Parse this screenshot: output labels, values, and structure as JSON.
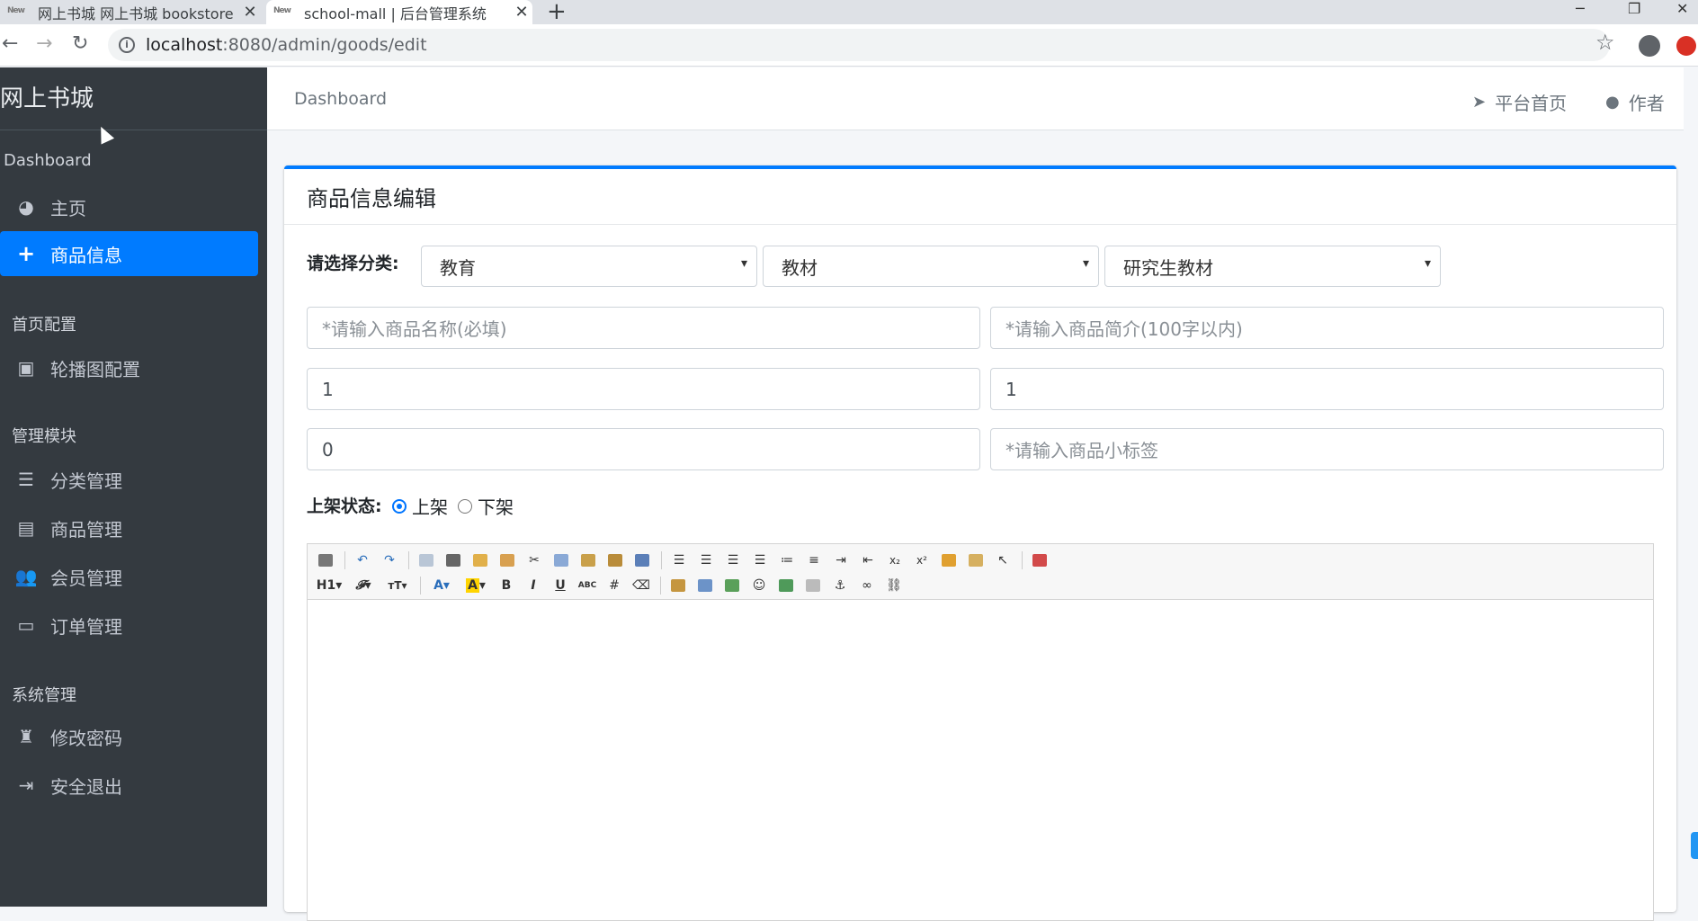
{
  "browser": {
    "tabs": [
      {
        "favicon": "New",
        "title": "网上书城 网上书城 bookstore",
        "active": false
      },
      {
        "favicon": "New",
        "title": "school-mall | 后台管理系统",
        "active": true
      }
    ],
    "url_host": "localhost",
    "url_rest": ":8080/admin/goods/edit"
  },
  "sidebar": {
    "brand": "网上书城",
    "sections": [
      {
        "title": "Dashboard",
        "items": [
          {
            "label": "主页",
            "icon": "dashboard-icon"
          },
          {
            "label": "商品信息",
            "icon": "plus-icon",
            "active": true
          }
        ]
      },
      {
        "title": "首页配置",
        "items": [
          {
            "label": "轮播图配置",
            "icon": "image-icon"
          }
        ]
      },
      {
        "title": "管理模块",
        "items": [
          {
            "label": "分类管理",
            "icon": "list-icon"
          },
          {
            "label": "商品管理",
            "icon": "archive-icon"
          },
          {
            "label": "会员管理",
            "icon": "users-icon"
          },
          {
            "label": "订单管理",
            "icon": "money-icon"
          }
        ]
      },
      {
        "title": "系统管理",
        "items": [
          {
            "label": "修改密码",
            "icon": "user-secret-icon"
          },
          {
            "label": "安全退出",
            "icon": "sign-out-icon"
          }
        ]
      }
    ]
  },
  "topnav": {
    "breadcrumb": "Dashboard",
    "home_link": "平台首页",
    "author_link": "作者"
  },
  "card": {
    "title": "商品信息编辑",
    "category_label": "请选择分类:",
    "categories": [
      "教育",
      "教材",
      "研究生教材"
    ],
    "fields": {
      "name_placeholder": "*请输入商品名称(必填)",
      "intro_placeholder": "*请输入商品简介(100字以内)",
      "field3_value": "1",
      "field4_value": "1",
      "field5_value": "0",
      "tag_placeholder": "*请输入商品小标签"
    },
    "status_label": "上架状态:",
    "status_on": "上架",
    "status_off": "下架"
  },
  "editor": {
    "heading_btn": "H1",
    "abc_btn": "ABC",
    "bold_btn": "B",
    "italic_btn": "I",
    "underline_btn": "U"
  }
}
